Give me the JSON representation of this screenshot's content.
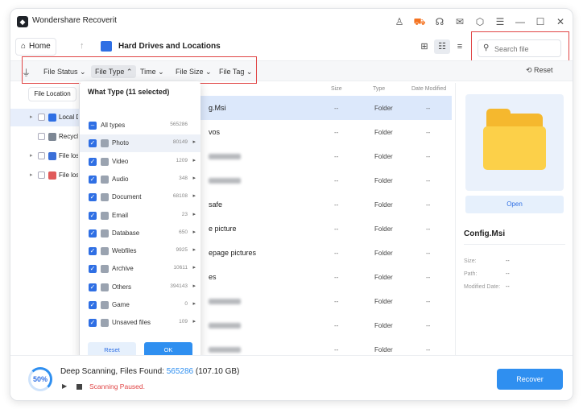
{
  "app": {
    "title": "Wondershare Recoverit"
  },
  "titlebar_icons": [
    "user-icon",
    "cart-icon",
    "headset-icon",
    "mail-icon",
    "settings-icon",
    "menu-icon",
    "minimize-icon",
    "maximize-icon",
    "close-icon"
  ],
  "nav": {
    "home": "Home",
    "location_title": "Hard Drives and Locations"
  },
  "search": {
    "placeholder": "Search file"
  },
  "filters": {
    "file_status": "File Status",
    "file_type": "File Type",
    "time": "Time",
    "file_size": "File Size",
    "file_tag": "File Tag",
    "reset": "Reset"
  },
  "sidebar": {
    "tab": "File Location",
    "items": [
      {
        "label": "Local Disk"
      },
      {
        "label": "Recycle Bin"
      },
      {
        "label": "File lost"
      },
      {
        "label": "File lost"
      }
    ]
  },
  "columns": {
    "size": "Size",
    "type": "Type",
    "date": "Date Modified"
  },
  "files": [
    {
      "name": "g.Msi",
      "size": "--",
      "type": "Folder",
      "date": "--"
    },
    {
      "name": "vos",
      "size": "--",
      "type": "Folder",
      "date": "--"
    },
    {
      "name": "",
      "size": "--",
      "type": "Folder",
      "date": "--"
    },
    {
      "name": "",
      "size": "--",
      "type": "Folder",
      "date": "--"
    },
    {
      "name": "safe",
      "size": "--",
      "type": "Folder",
      "date": "--"
    },
    {
      "name": "e picture",
      "size": "--",
      "type": "Folder",
      "date": "--"
    },
    {
      "name": "epage pictures",
      "size": "--",
      "type": "Folder",
      "date": "--"
    },
    {
      "name": "es",
      "size": "--",
      "type": "Folder",
      "date": "--"
    },
    {
      "name": "",
      "size": "--",
      "type": "Folder",
      "date": "--"
    },
    {
      "name": "",
      "size": "--",
      "type": "Folder",
      "date": "--"
    },
    {
      "name": "",
      "size": "--",
      "type": "Folder",
      "date": "--"
    }
  ],
  "dropdown": {
    "title": "What Type (11 selected)",
    "items": [
      {
        "label": "All types",
        "count": "565286"
      },
      {
        "label": "Photo",
        "count": "80149"
      },
      {
        "label": "Video",
        "count": "1209"
      },
      {
        "label": "Audio",
        "count": "348"
      },
      {
        "label": "Document",
        "count": "68108"
      },
      {
        "label": "Email",
        "count": "23"
      },
      {
        "label": "Database",
        "count": "650"
      },
      {
        "label": "Webfiles",
        "count": "9925"
      },
      {
        "label": "Archive",
        "count": "10611"
      },
      {
        "label": "Others",
        "count": "394143"
      },
      {
        "label": "Game",
        "count": "0"
      },
      {
        "label": "Unsaved files",
        "count": "109"
      }
    ],
    "reset": "Reset",
    "ok": "OK"
  },
  "preview": {
    "open": "Open",
    "name": "Config.Msi",
    "size_label": "Size:",
    "size_value": "--",
    "path_label": "Path:",
    "path_value": "--",
    "modified_label": "Modified Date:",
    "modified_value": "--"
  },
  "scan": {
    "progress": "50%",
    "title_prefix": "Deep Scanning, Files Found: ",
    "count": "565286",
    "size": " (107.10 GB)",
    "status": "Scanning Paused."
  },
  "recover": "Recover"
}
